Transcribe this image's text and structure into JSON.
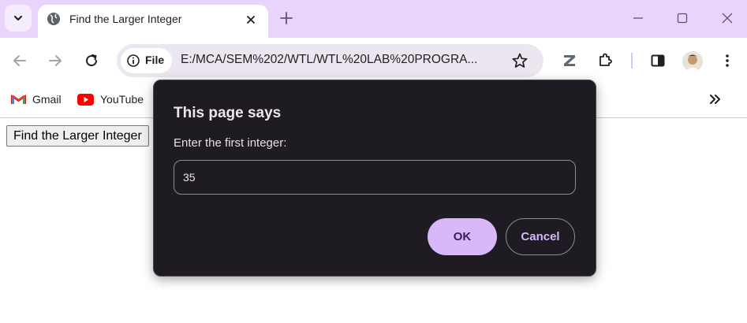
{
  "tab": {
    "title": "Find the Larger Integer"
  },
  "address_bar": {
    "chip_label": "File",
    "url": "E:/MCA/SEM%202/WTL/WTL%20LAB%20PROGRA..."
  },
  "bookmarks": [
    {
      "label": "Gmail",
      "icon": "gmail-icon"
    },
    {
      "label": "YouTube",
      "icon": "youtube-icon"
    }
  ],
  "page": {
    "button_label": "Find the Larger Integer"
  },
  "dialog": {
    "title": "This page says",
    "message": "Enter the first integer:",
    "input_value": "35",
    "ok_label": "OK",
    "cancel_label": "Cancel"
  },
  "colors": {
    "tab_strip": "#e9d5fc",
    "dialog_bg": "#1f1b22",
    "accent": "#d8b8f8"
  }
}
